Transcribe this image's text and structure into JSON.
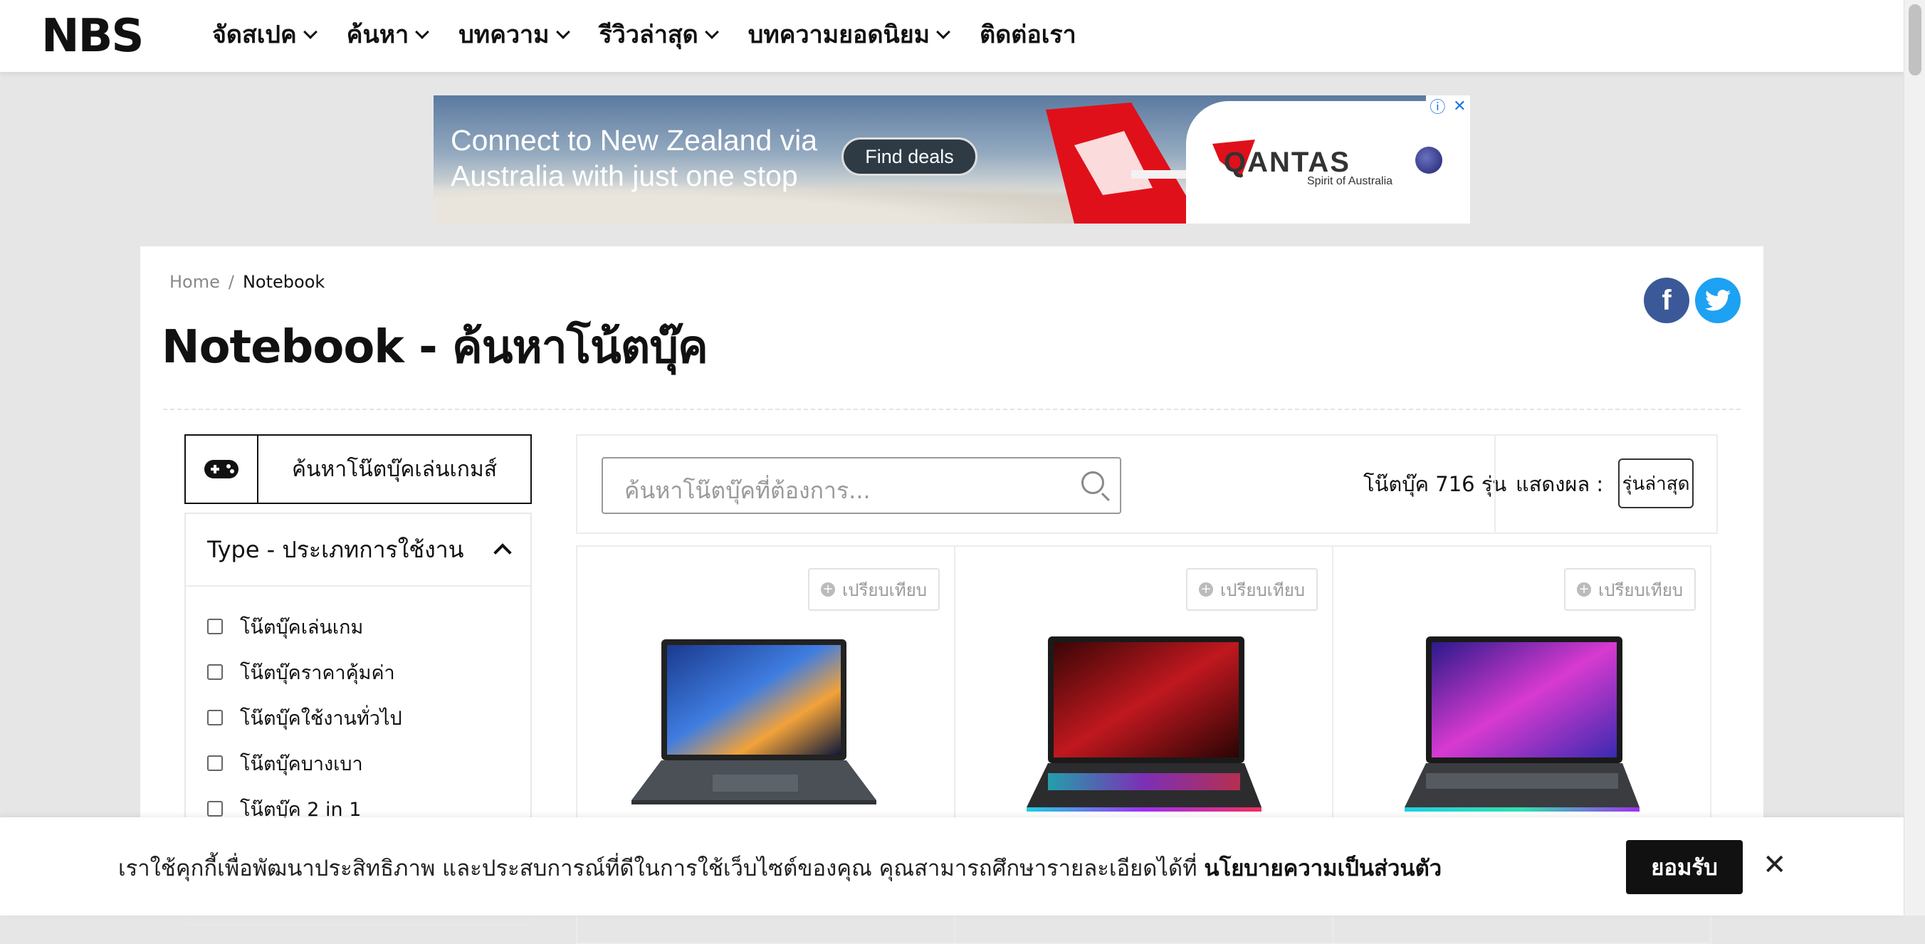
{
  "nav": {
    "logo": "NBS",
    "items": [
      {
        "label": "จัดสเปค",
        "has_dropdown": true
      },
      {
        "label": "ค้นหา",
        "has_dropdown": true
      },
      {
        "label": "บทความ",
        "has_dropdown": true
      },
      {
        "label": "รีวิวล่าสุด",
        "has_dropdown": true
      },
      {
        "label": "บทความยอดนิยม",
        "has_dropdown": true
      },
      {
        "label": "ติดต่อเรา",
        "has_dropdown": false
      }
    ]
  },
  "ad": {
    "headline_line1": "Connect to New Zealand via",
    "headline_line2": "Australia with just one stop",
    "button": "Find deals",
    "brand": "QANTAS",
    "brand_tagline": "Spirit of Australia",
    "info_icon": "info-icon",
    "close_icon": "close-icon"
  },
  "breadcrumb": {
    "home": "Home",
    "separator": "/",
    "current": "Notebook"
  },
  "page_title": "Notebook - ค้นหาโน้ตบุ๊ค",
  "social": {
    "facebook": "f",
    "twitter": "twitter-icon"
  },
  "sidebar": {
    "gaming_button": "ค้นหาโน๊ตบุ๊คเล่นเกมส์",
    "filter_title": "Type - ประเภทการใช้งาน",
    "filters": [
      "โน๊ตบุ๊คเล่นเกม",
      "โน๊ตบุ๊คราคาคุ้มค่า",
      "โน๊ตบุ๊คใช้งานทั่วไป",
      "โน๊ตบุ๊คบางเบา",
      "โน๊ตบุ๊ค 2 in 1"
    ]
  },
  "toolbar": {
    "search_placeholder": "ค้นหาโน๊ตบุ๊คที่ต้องการ...",
    "count": "โน๊ตบุ๊ค 716 รุ่น",
    "sort_label": "แสดงผล :",
    "sort_value": "รุ่นล่าสุด"
  },
  "products": [
    {
      "compare": "เปรียบเทียบ",
      "image": "laptop-oled-colorful"
    },
    {
      "compare": "เปรียบเทียบ",
      "image": "laptop-gaming-red"
    },
    {
      "compare": "เปรียบเทียบ",
      "image": "laptop-gaming-purple"
    }
  ],
  "cookie": {
    "text": "เราใช้คุกกี้เพื่อพัฒนาประสิทธิภาพ และประสบการณ์ที่ดีในการใช้เว็บไซต์ของคุณ คุณสามารถศึกษารายละเอียดได้ที่ ",
    "link": "นโยบายความเป็นส่วนตัว",
    "accept": "ยอมรับ",
    "close": "✕"
  },
  "colors": {
    "facebook": "#3b5998",
    "twitter": "#1da1f2",
    "accept_bg": "#111111",
    "qantas_red": "#e0101a"
  }
}
